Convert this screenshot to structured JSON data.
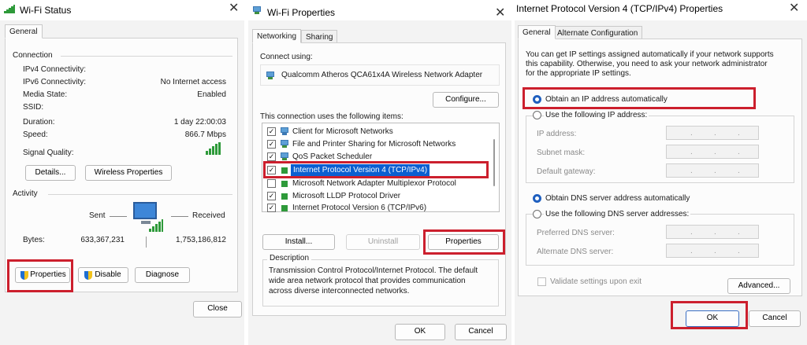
{
  "status_window": {
    "title": "Wi-Fi Status",
    "close_glyph": "✕",
    "tab": "General",
    "connection": {
      "heading": "Connection",
      "rows": [
        {
          "label": "IPv4 Connectivity:",
          "value": ""
        },
        {
          "label": "IPv6 Connectivity:",
          "value": "No Internet access"
        },
        {
          "label": "Media State:",
          "value": "Enabled"
        },
        {
          "label": "SSID:",
          "value": ""
        },
        {
          "label": "Duration:",
          "value": "1 day 22:00:03"
        },
        {
          "label": "Speed:",
          "value": "866.7 Mbps"
        }
      ],
      "signal_label": "Signal Quality:",
      "signal_bars": 5
    },
    "details_btn": "Details...",
    "wireless_btn": "Wireless Properties",
    "activity": {
      "heading": "Activity",
      "sent_label": "Sent",
      "received_label": "Received",
      "bytes_label": "Bytes:",
      "sent_value": "633,367,231",
      "received_value": "1,753,186,812"
    },
    "properties_btn": "Properties",
    "disable_btn": "Disable",
    "diagnose_btn": "Diagnose",
    "close_btn": "Close"
  },
  "props_window": {
    "title": "Wi-Fi Properties",
    "close_glyph": "✕",
    "tabs": [
      "Networking",
      "Sharing"
    ],
    "connect_using_label": "Connect using:",
    "adapter": "Qualcomm Atheros QCA61x4A Wireless Network Adapter",
    "configure_btn": "Configure...",
    "items_label": "This connection uses the following items:",
    "items": [
      {
        "label": "Client for Microsoft Networks",
        "checked": true
      },
      {
        "label": "File and Printer Sharing for Microsoft Networks",
        "checked": true
      },
      {
        "label": "QoS Packet Scheduler",
        "checked": true
      },
      {
        "label": "Internet Protocol Version 4 (TCP/IPv4)",
        "checked": true
      },
      {
        "label": "Microsoft Network Adapter Multiplexor Protocol",
        "checked": false
      },
      {
        "label": "Microsoft LLDP Protocol Driver",
        "checked": true
      },
      {
        "label": "Internet Protocol Version 6 (TCP/IPv6)",
        "checked": true
      }
    ],
    "selected_item": 3,
    "check_glyph": "✓",
    "install_btn": "Install...",
    "uninstall_btn": "Uninstall",
    "properties_btn": "Properties",
    "description_heading": "Description",
    "description_lines": [
      "Transmission Control Protocol/Internet Protocol. The default",
      "wide area network protocol that provides communication",
      "across diverse interconnected networks."
    ],
    "ok_btn": "OK",
    "cancel_btn": "Cancel"
  },
  "ipv4_window": {
    "title": "Internet Protocol Version 4 (TCP/IPv4) Properties",
    "close_glyph": "✕",
    "tabs": [
      "General",
      "Alternate Configuration"
    ],
    "intro_lines": [
      "You can get IP settings assigned automatically if your network supports",
      "this capability. Otherwise, you need to ask your network administrator",
      "for the appropriate IP settings."
    ],
    "obtain_ip_auto": "Obtain an IP address automatically",
    "use_following_ip": "Use the following IP address:",
    "ip_address_label": "IP address:",
    "subnet_mask_label": "Subnet mask:",
    "default_gateway_label": "Default gateway:",
    "obtain_dns_auto": "Obtain DNS server address automatically",
    "use_following_dns": "Use the following DNS server addresses:",
    "preferred_dns_label": "Preferred DNS server:",
    "alternate_dns_label": "Alternate DNS server:",
    "ip_dots": ".",
    "validate_label": "Validate settings upon exit",
    "advanced_btn": "Advanced...",
    "ok_btn": "OK",
    "cancel_btn": "Cancel"
  },
  "colors": {
    "highlight_red": "#cc1f2d",
    "selection_blue": "#0a5fd1",
    "signal_green": "#2e9a3a"
  }
}
